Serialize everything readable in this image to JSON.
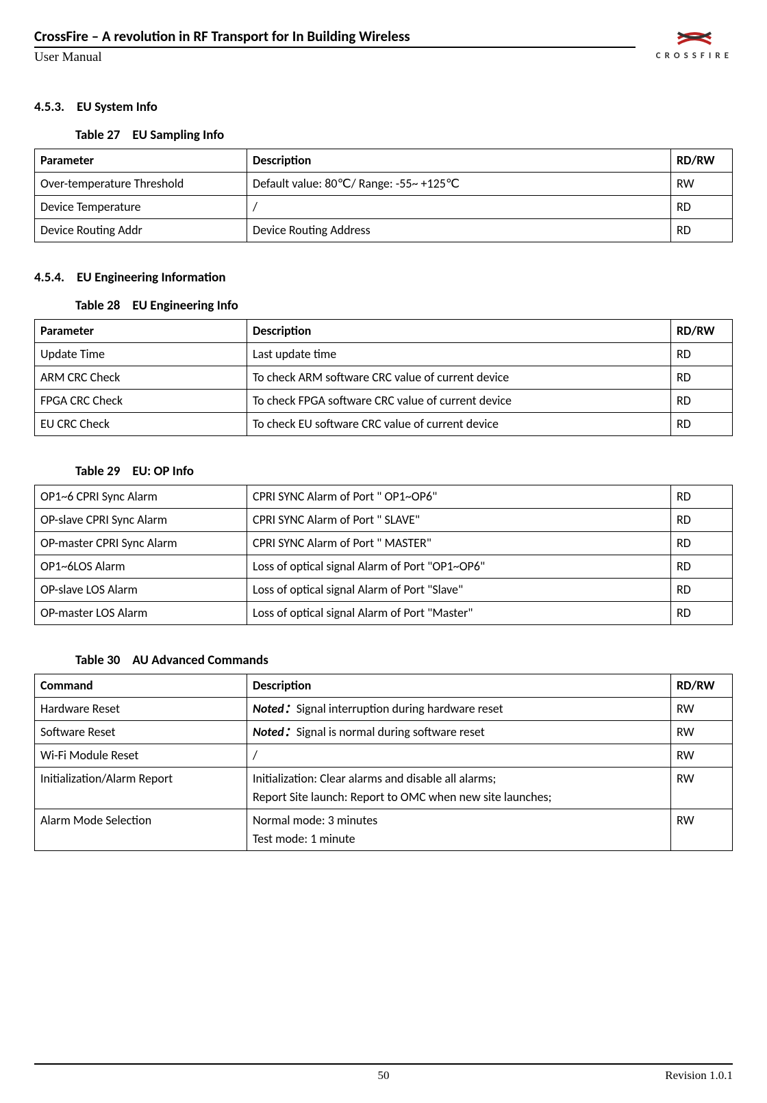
{
  "header": {
    "title": "CrossFire – A revolution in RF Transport for In Building Wireless",
    "subtitle": "User Manual",
    "logo_text": "CROSSFIRE"
  },
  "sections": {
    "s453": {
      "num": "4.5.3.",
      "title": "EU System Info"
    },
    "s454": {
      "num": "4.5.4.",
      "title": "EU Engineering Information"
    }
  },
  "tables": {
    "t27": {
      "num": "Table 27",
      "title": "EU Sampling Info",
      "head": [
        "Parameter",
        "Description",
        "RD/RW"
      ],
      "rows": [
        [
          "Over-temperature Threshold",
          "Default value: 80℃/ Range: -55~ +125℃",
          "RW"
        ],
        [
          "Device Temperature",
          "/",
          "RD"
        ],
        [
          "Device Routing Addr",
          "Device Routing Address",
          "RD"
        ]
      ]
    },
    "t28": {
      "num": "Table 28",
      "title": "EU Engineering Info",
      "head": [
        "Parameter",
        "Description",
        "RD/RW"
      ],
      "rows": [
        [
          "Update Time",
          "Last update time",
          "RD"
        ],
        [
          "ARM CRC Check",
          "To check ARM software CRC value of current device",
          "RD"
        ],
        [
          "FPGA CRC Check",
          "To check FPGA software CRC value of current device",
          "RD"
        ],
        [
          "EU CRC Check",
          "To check EU software CRC value of current device",
          "RD"
        ]
      ]
    },
    "t29": {
      "num": "Table 29",
      "title": "EU: OP Info",
      "rows": [
        [
          "OP1~6 CPRI Sync Alarm",
          "CPRI SYNC Alarm of Port \" OP1~OP6\"",
          "RD"
        ],
        [
          "OP-slave CPRI Sync Alarm",
          "CPRI SYNC Alarm of Port \" SLAVE\"",
          "RD"
        ],
        [
          "OP-master CPRI Sync Alarm",
          "CPRI SYNC Alarm of Port \" MASTER\"",
          "RD"
        ],
        [
          "OP1~6LOS Alarm",
          "Loss of optical signal Alarm of Port \"OP1~OP6\"",
          "RD"
        ],
        [
          "OP-slave LOS Alarm",
          "Loss of optical signal Alarm of Port \"Slave\"",
          "RD"
        ],
        [
          "OP-master LOS Alarm",
          "Loss of optical signal Alarm of Port \"Master\"",
          "RD"
        ]
      ]
    },
    "t30": {
      "num": "Table 30",
      "title": "AU Advanced Commands",
      "head": [
        "Command",
        "Description",
        "RD/RW"
      ],
      "rows": [
        {
          "c0": "Hardware Reset",
          "noted": "Noted：",
          "rest": "Signal interruption during hardware reset",
          "rw": "RW"
        },
        {
          "c0": "Software Reset",
          "noted": "Noted：",
          "rest": "Signal is normal during software reset",
          "rw": "RW"
        },
        {
          "c0": "Wi-Fi Module Reset",
          "desc": "/",
          "rw": "RW"
        },
        {
          "c0": "Initialization/Alarm Report",
          "desc": "Initialization: Clear alarms and disable all alarms;\nReport Site launch: Report to OMC when new site launches;",
          "rw": "RW"
        },
        {
          "c0": "Alarm Mode Selection",
          "desc": "Normal mode: 3 minutes\nTest mode: 1 minute",
          "rw": "RW"
        }
      ]
    }
  },
  "footer": {
    "page": "50",
    "revision": "Revision 1.0.1"
  }
}
